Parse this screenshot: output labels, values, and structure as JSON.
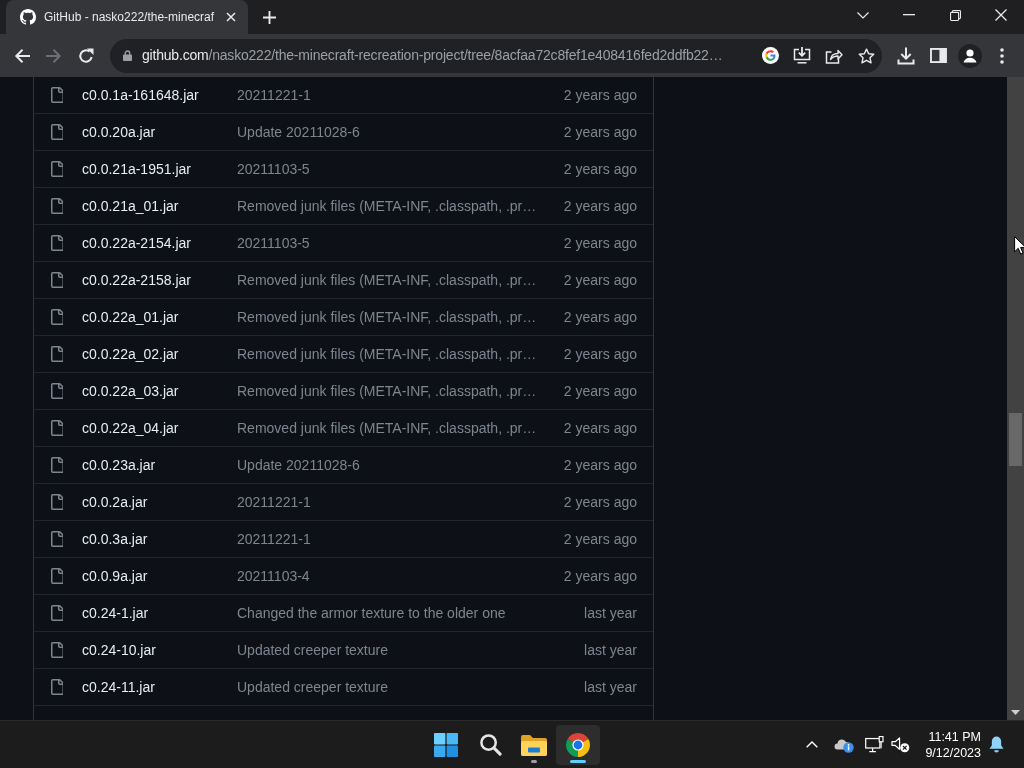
{
  "browser": {
    "tabs": [
      {
        "title": "GitHub - nasko222/the-minecraf",
        "selected": true
      }
    ],
    "address_bar": {
      "host": "github.com",
      "path": "/nasko222/the-minecraft-recreation-project/tree/8acfaa72c8fef1e408416fed2ddfb22…"
    }
  },
  "file_list": {
    "rows": [
      {
        "name": "c0.0.1a-161648.jar",
        "message": "20211221-1",
        "date": "2 years ago"
      },
      {
        "name": "c0.0.20a.jar",
        "message": "Update 20211028-6",
        "date": "2 years ago"
      },
      {
        "name": "c0.0.21a-1951.jar",
        "message": "20211103-5",
        "date": "2 years ago"
      },
      {
        "name": "c0.0.21a_01.jar",
        "message": "Removed junk files (META-INF, .classpath, .pr…",
        "date": "2 years ago"
      },
      {
        "name": "c0.0.22a-2154.jar",
        "message": "20211103-5",
        "date": "2 years ago"
      },
      {
        "name": "c0.0.22a-2158.jar",
        "message": "Removed junk files (META-INF, .classpath, .pr…",
        "date": "2 years ago"
      },
      {
        "name": "c0.0.22a_01.jar",
        "message": "Removed junk files (META-INF, .classpath, .pr…",
        "date": "2 years ago"
      },
      {
        "name": "c0.0.22a_02.jar",
        "message": "Removed junk files (META-INF, .classpath, .pr…",
        "date": "2 years ago"
      },
      {
        "name": "c0.0.22a_03.jar",
        "message": "Removed junk files (META-INF, .classpath, .pr…",
        "date": "2 years ago"
      },
      {
        "name": "c0.0.22a_04.jar",
        "message": "Removed junk files (META-INF, .classpath, .pr…",
        "date": "2 years ago"
      },
      {
        "name": "c0.0.23a.jar",
        "message": "Update 20211028-6",
        "date": "2 years ago"
      },
      {
        "name": "c0.0.2a.jar",
        "message": "20211221-1",
        "date": "2 years ago"
      },
      {
        "name": "c0.0.3a.jar",
        "message": "20211221-1",
        "date": "2 years ago"
      },
      {
        "name": "c0.0.9a.jar",
        "message": "20211103-4",
        "date": "2 years ago"
      },
      {
        "name": "c0.24-1.jar",
        "message": "Changed the armor texture to the older one",
        "date": "last year"
      },
      {
        "name": "c0.24-10.jar",
        "message": "Updated creeper texture",
        "date": "last year"
      },
      {
        "name": "c0.24-11.jar",
        "message": "Updated creeper texture",
        "date": "last year"
      }
    ]
  },
  "taskbar": {
    "apps": [
      {
        "kind": "start",
        "running": false,
        "selected": false
      },
      {
        "kind": "search",
        "running": false,
        "selected": false
      },
      {
        "kind": "explorer",
        "running": true,
        "selected": false
      },
      {
        "kind": "browser",
        "running": true,
        "selected": true
      }
    ],
    "clock": {
      "time": "11:41 PM",
      "date": "9/12/2023"
    }
  }
}
